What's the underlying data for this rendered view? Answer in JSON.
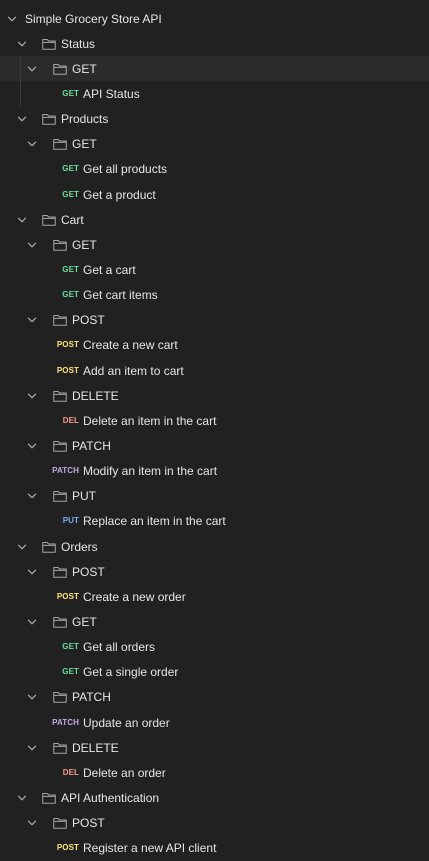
{
  "colors": {
    "background": "#212121",
    "highlight": "#2b2b2b",
    "text": "#e6e6e6",
    "icon": "#a6a6a6",
    "method_get": "#6bdd9a",
    "method_post": "#ffe47e",
    "method_delete": "#f79a8e",
    "method_patch": "#c0a8e1",
    "method_put": "#74aef6"
  },
  "collection": {
    "name": "Simple Grocery Store API",
    "tree": [
      {
        "kind": "collection",
        "depth": 0,
        "label": "Simple Grocery Store API",
        "icon": "chevron-down-icon"
      },
      {
        "kind": "folder",
        "depth": 1,
        "label": "Status",
        "icon": "folder-icon"
      },
      {
        "kind": "folder",
        "depth": 2,
        "label": "GET",
        "icon": "folder-icon",
        "highlighted": true
      },
      {
        "kind": "request",
        "depth": 3,
        "method": "GET",
        "method_label": "GET",
        "label": "API Status"
      },
      {
        "kind": "folder",
        "depth": 1,
        "label": "Products",
        "icon": "folder-icon"
      },
      {
        "kind": "folder",
        "depth": 2,
        "label": "GET",
        "icon": "folder-icon"
      },
      {
        "kind": "request",
        "depth": 3,
        "method": "GET",
        "method_label": "GET",
        "label": "Get all products"
      },
      {
        "kind": "request",
        "depth": 3,
        "method": "GET",
        "method_label": "GET",
        "label": "Get a product"
      },
      {
        "kind": "folder",
        "depth": 1,
        "label": "Cart",
        "icon": "folder-icon"
      },
      {
        "kind": "folder",
        "depth": 2,
        "label": "GET",
        "icon": "folder-icon"
      },
      {
        "kind": "request",
        "depth": 3,
        "method": "GET",
        "method_label": "GET",
        "label": "Get a cart"
      },
      {
        "kind": "request",
        "depth": 3,
        "method": "GET",
        "method_label": "GET",
        "label": "Get cart items"
      },
      {
        "kind": "folder",
        "depth": 2,
        "label": "POST",
        "icon": "folder-icon"
      },
      {
        "kind": "request",
        "depth": 3,
        "method": "POST",
        "method_label": "POST",
        "label": "Create a new cart"
      },
      {
        "kind": "request",
        "depth": 3,
        "method": "POST",
        "method_label": "POST",
        "label": "Add an item to cart"
      },
      {
        "kind": "folder",
        "depth": 2,
        "label": "DELETE",
        "icon": "folder-icon"
      },
      {
        "kind": "request",
        "depth": 3,
        "method": "DELETE",
        "method_label": "DEL",
        "label": "Delete an item in the cart"
      },
      {
        "kind": "folder",
        "depth": 2,
        "label": "PATCH",
        "icon": "folder-icon"
      },
      {
        "kind": "request",
        "depth": 3,
        "method": "PATCH",
        "method_label": "PATCH",
        "label": "Modify an item in the cart"
      },
      {
        "kind": "folder",
        "depth": 2,
        "label": "PUT",
        "icon": "folder-icon"
      },
      {
        "kind": "request",
        "depth": 3,
        "method": "PUT",
        "method_label": "PUT",
        "label": "Replace an item in the cart"
      },
      {
        "kind": "folder",
        "depth": 1,
        "label": "Orders",
        "icon": "folder-icon"
      },
      {
        "kind": "folder",
        "depth": 2,
        "label": "POST",
        "icon": "folder-icon"
      },
      {
        "kind": "request",
        "depth": 3,
        "method": "POST",
        "method_label": "POST",
        "label": "Create a new order"
      },
      {
        "kind": "folder",
        "depth": 2,
        "label": "GET",
        "icon": "folder-icon"
      },
      {
        "kind": "request",
        "depth": 3,
        "method": "GET",
        "method_label": "GET",
        "label": "Get all orders"
      },
      {
        "kind": "request",
        "depth": 3,
        "method": "GET",
        "method_label": "GET",
        "label": "Get a single order"
      },
      {
        "kind": "folder",
        "depth": 2,
        "label": "PATCH",
        "icon": "folder-icon"
      },
      {
        "kind": "request",
        "depth": 3,
        "method": "PATCH",
        "method_label": "PATCH",
        "label": "Update an order"
      },
      {
        "kind": "folder",
        "depth": 2,
        "label": "DELETE",
        "icon": "folder-icon"
      },
      {
        "kind": "request",
        "depth": 3,
        "method": "DELETE",
        "method_label": "DEL",
        "label": "Delete an order"
      },
      {
        "kind": "folder",
        "depth": 1,
        "label": "API Authentication",
        "icon": "folder-icon"
      },
      {
        "kind": "folder",
        "depth": 2,
        "label": "POST",
        "icon": "folder-icon"
      },
      {
        "kind": "request",
        "depth": 3,
        "method": "POST",
        "method_label": "POST",
        "label": "Register a new API client"
      }
    ]
  }
}
